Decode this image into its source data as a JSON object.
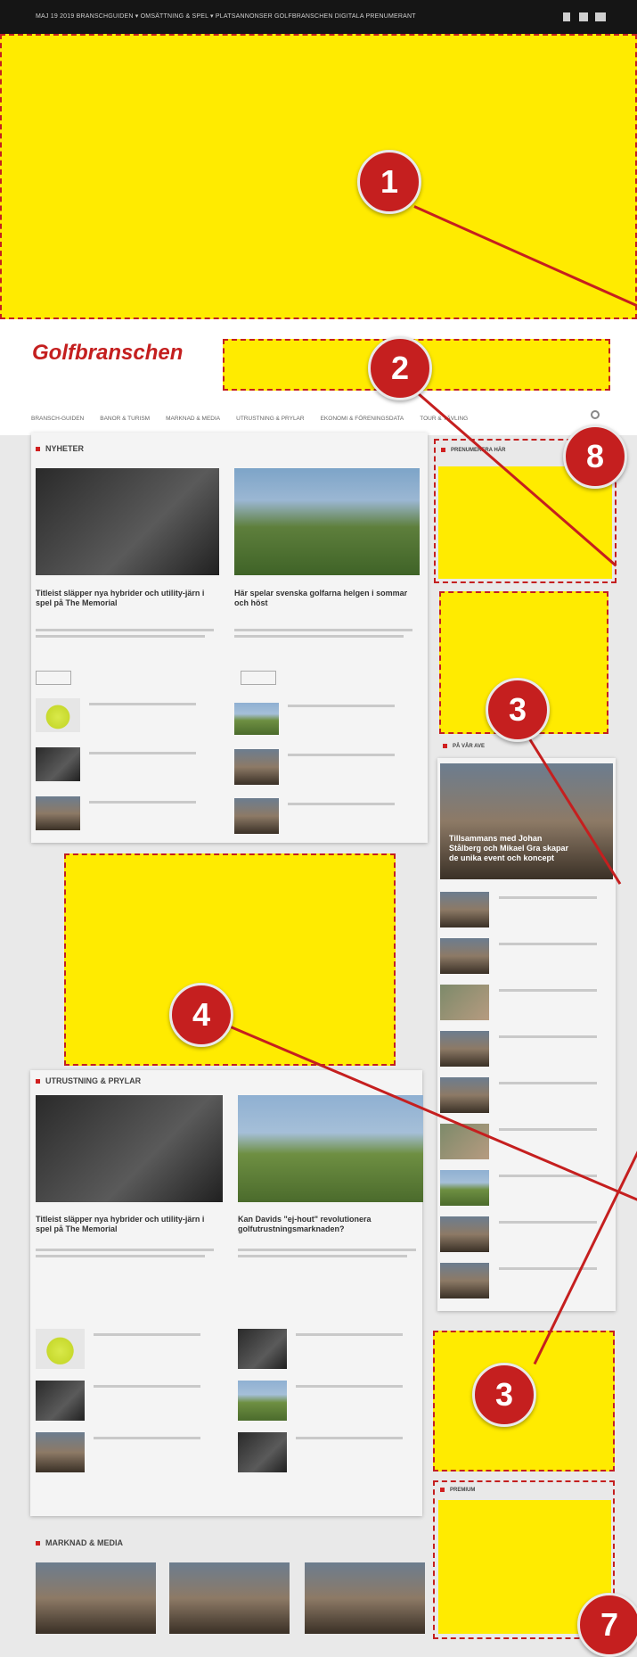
{
  "topbar": {
    "text": "MAJ 19 2019    BRANSCHGUIDEN ▾    OMSÄTTNING & SPEL ▾    PLATSANNONSER    GOLFBRANSCHEN    DIGITALA PRENUMERANT",
    "icons": [
      "facebook-icon",
      "twitter-icon",
      "mail-icon"
    ]
  },
  "header": {
    "logo": "Golfbranschen",
    "logo_color": "#c41f1f",
    "search_icon": "search-icon"
  },
  "nav": {
    "items": [
      "BRANSCH-GUIDEN",
      "BANOR & TURISM",
      "MARKNAD & MEDIA",
      "UTRUSTNING & PRYLAR",
      "EKONOMI & FÖRENINGSDATA",
      "TOUR & TÄVLING"
    ]
  },
  "sections": {
    "nyheter": "NYHETER",
    "utrustning": "UTRUSTNING & PRYLAR",
    "marknad": "MARKNAD & MEDIA",
    "premium": "PREMIUM",
    "pa_vaaraen": "PÅ VÅR AVE",
    "small_sidebar_title": "PRENUMERERA HÄR"
  },
  "articles": {
    "nyheter_main_1": "Titleist släpper nya hybrider och utility-järn i spel på The Memorial",
    "nyheter_main_2": "Här spelar svenska golfarna helgen i sommar och höst",
    "utrustning_main_1": "Titleist släpper nya hybrider och utility-järn i spel på The Memorial",
    "utrustning_main_2": "Kan Davids \"ej-hout\" revolutionera golfutrustningsmarknaden?",
    "sidebar_feature": "Tillsammans med Johan Stålberg och Mikael Gra skapar de unika event och koncept"
  },
  "badges": [
    "1",
    "2",
    "3",
    "4",
    "8",
    "3",
    "7"
  ],
  "colors": {
    "highlight": "#ffeb00",
    "accent": "#c51f1f"
  }
}
